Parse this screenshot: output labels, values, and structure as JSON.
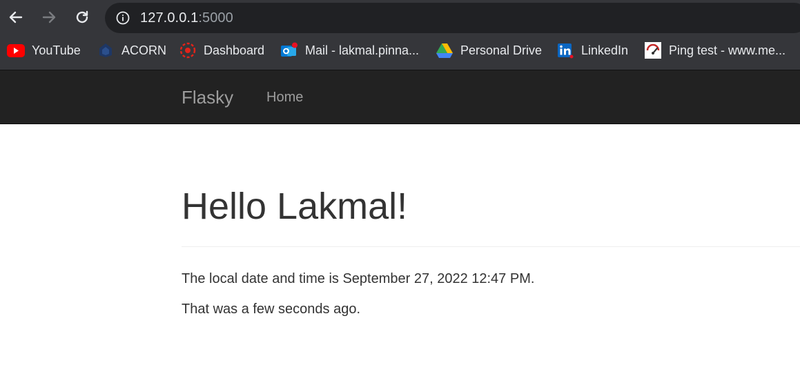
{
  "browser": {
    "url_host": "127.0.0.1",
    "url_port": ":5000",
    "bookmarks": [
      {
        "label": "YouTube",
        "icon": "youtube-icon",
        "color": "#ff0000"
      },
      {
        "label": "ACORN",
        "icon": "acorn-icon",
        "color": "#1e3765"
      },
      {
        "label": "Dashboard",
        "icon": "dashboard-icon",
        "color": "#e2231a"
      },
      {
        "label": "Mail - lakmal.pinna...",
        "icon": "outlook-icon",
        "color": "#0078d4"
      },
      {
        "label": "Personal Drive",
        "icon": "google-drive-icon",
        "color": "#34a853"
      },
      {
        "label": "LinkedIn",
        "icon": "linkedin-icon",
        "color": "#0a66c2"
      },
      {
        "label": "Ping test - www.me...",
        "icon": "ping-test-icon",
        "color": "#c62828"
      }
    ]
  },
  "navbar": {
    "brand": "Flasky",
    "links": [
      {
        "label": "Home"
      }
    ]
  },
  "page": {
    "heading": "Hello Lakmal!",
    "local_time_text": "The local date and time is September 27, 2022 12:47 PM.",
    "relative_time_text": "That was a few seconds ago."
  }
}
